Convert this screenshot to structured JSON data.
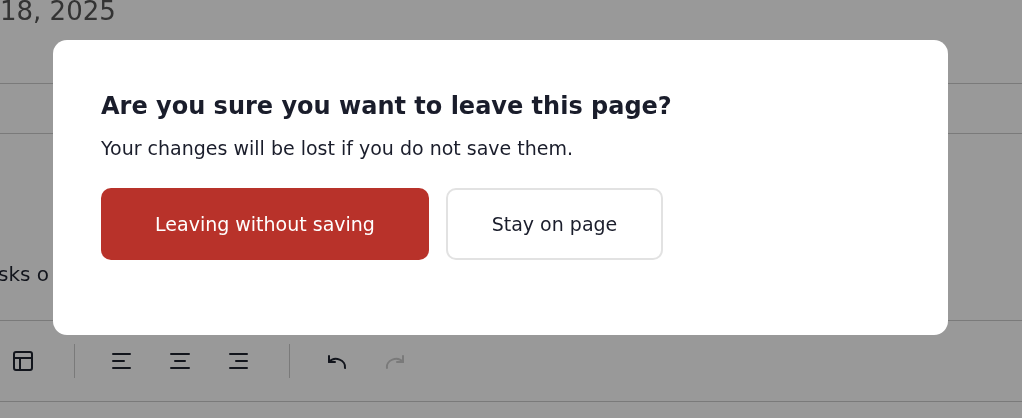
{
  "page": {
    "date": "18, 2025",
    "body_text": "sks o"
  },
  "toolbar_groups": [
    {
      "buttons": [
        {
          "kind": "table",
          "disabled": false
        }
      ]
    },
    {
      "buttons": [
        {
          "kind": "align-left",
          "disabled": false
        },
        {
          "kind": "align-center",
          "disabled": false
        },
        {
          "kind": "align-right",
          "disabled": false
        }
      ]
    },
    {
      "buttons": [
        {
          "kind": "undo",
          "disabled": false
        },
        {
          "kind": "redo",
          "disabled": true
        }
      ]
    }
  ],
  "dialog": {
    "title": "Are you sure you want to leave this page?",
    "message": "Your changes will be lost if you do not save them.",
    "buttons": [
      {
        "label": "Leaving without saving",
        "kind": "danger"
      },
      {
        "label": "Stay on page",
        "kind": "secondary"
      }
    ]
  }
}
